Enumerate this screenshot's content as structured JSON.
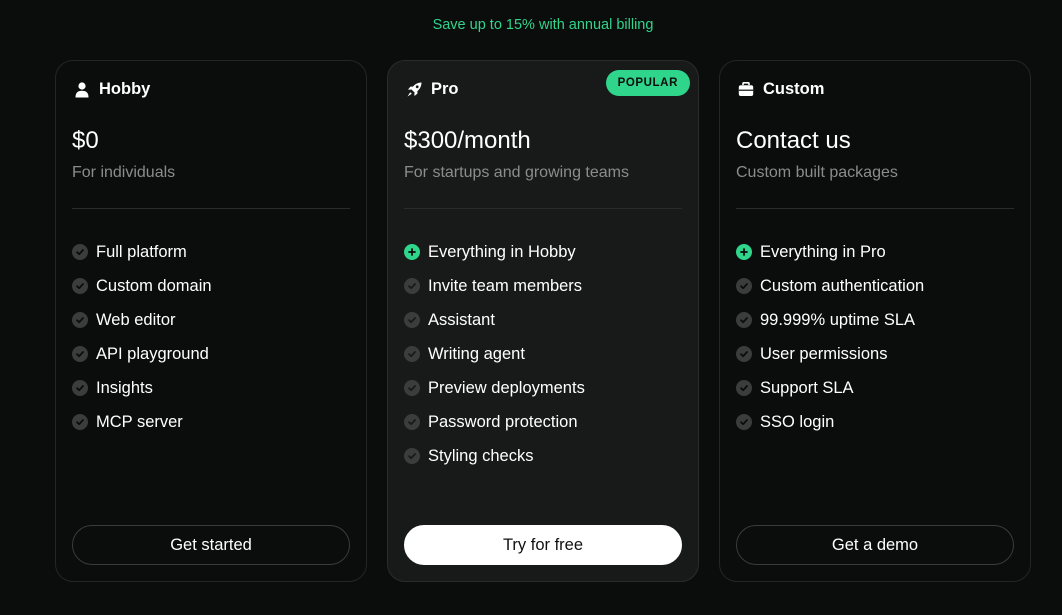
{
  "billing_note": "Save up to 15% with annual billing",
  "colors": {
    "accent": "#2fd58b",
    "background": "#0b0c0c",
    "featured_card": "#181a19",
    "muted_text": "#8a8d8c"
  },
  "plans": [
    {
      "name": "Hobby",
      "icon": "user-icon",
      "price": "$0",
      "subtitle": "For individuals",
      "features": [
        {
          "label": "Full platform",
          "icon": "check-circle-icon"
        },
        {
          "label": "Custom domain",
          "icon": "check-circle-icon"
        },
        {
          "label": "Web editor",
          "icon": "check-circle-icon"
        },
        {
          "label": "API playground",
          "icon": "check-circle-icon"
        },
        {
          "label": "Insights",
          "icon": "check-circle-icon"
        },
        {
          "label": "MCP server",
          "icon": "check-circle-icon"
        }
      ],
      "cta": "Get started"
    },
    {
      "name": "Pro",
      "icon": "rocket-icon",
      "badge": "POPULAR",
      "price": "$300/month",
      "subtitle": "For startups and growing teams",
      "features": [
        {
          "label": "Everything in Hobby",
          "icon": "plus-circle-icon"
        },
        {
          "label": "Invite team members",
          "icon": "check-circle-icon"
        },
        {
          "label": "Assistant",
          "icon": "check-circle-icon"
        },
        {
          "label": "Writing agent",
          "icon": "check-circle-icon"
        },
        {
          "label": "Preview deployments",
          "icon": "check-circle-icon"
        },
        {
          "label": "Password protection",
          "icon": "check-circle-icon"
        },
        {
          "label": "Styling checks",
          "icon": "check-circle-icon"
        }
      ],
      "cta": "Try for free"
    },
    {
      "name": "Custom",
      "icon": "briefcase-icon",
      "price": "Contact us",
      "subtitle": "Custom built packages",
      "features": [
        {
          "label": "Everything in Pro",
          "icon": "plus-circle-icon"
        },
        {
          "label": "Custom authentication",
          "icon": "check-circle-icon"
        },
        {
          "label": "99.999% uptime SLA",
          "icon": "check-circle-icon"
        },
        {
          "label": "User permissions",
          "icon": "check-circle-icon"
        },
        {
          "label": "Support SLA",
          "icon": "check-circle-icon"
        },
        {
          "label": "SSO login",
          "icon": "check-circle-icon"
        }
      ],
      "cta": "Get a demo"
    }
  ]
}
